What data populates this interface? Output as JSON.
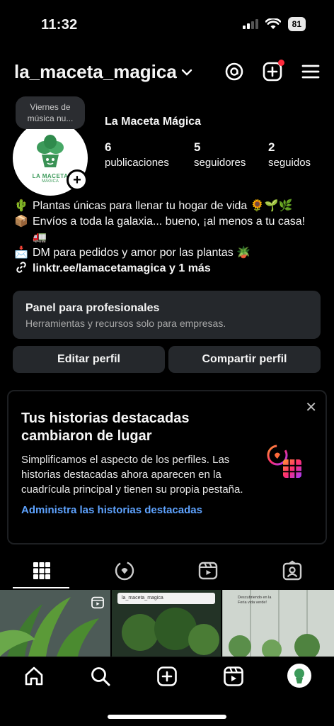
{
  "status": {
    "time": "11:32",
    "battery": "81"
  },
  "header": {
    "username": "la_maceta_magica"
  },
  "note": {
    "text_line1": "Viernes de",
    "text_line2": "música nu..."
  },
  "avatar": {
    "logo_line1": "LA MACETA",
    "logo_line2": "MÁGICA"
  },
  "profile": {
    "display_name": "La Maceta Mágica",
    "stats": [
      {
        "value": "6",
        "label": "publicaciones"
      },
      {
        "value": "5",
        "label": "seguidores"
      },
      {
        "value": "2",
        "label": "seguidos"
      }
    ]
  },
  "bio": {
    "line1": "Plantas únicas para llenar tu hogar de vida 🌻🌱🌿",
    "line2": "Envíos a toda la galaxia... bueno, ¡al menos a tu casa! 🚛",
    "line3": "DM para pedidos y amor por las plantas 🪴",
    "link": "linktr.ee/lamacetamagica y 1 más"
  },
  "pro_panel": {
    "title": "Panel para profesionales",
    "subtitle": "Herramientas y recursos solo para empresas."
  },
  "buttons": {
    "edit": "Editar perfil",
    "share": "Compartir perfil"
  },
  "highlights_card": {
    "title": "Tus historias destacadas cambiaron de lugar",
    "body": "Simplificamos el aspecto de los perfiles. Las historias destacadas ahora aparecen en la cuadrícula principal y tienen su propia pestaña.",
    "action": "Administra las historias destacadas"
  },
  "tile_texts": {
    "tile2_header": "la_maceta_magica",
    "tile3_caption": "Descubriendo en la Feria vida verde!"
  },
  "colors": {
    "background": "#000000",
    "panel": "#25282c",
    "link": "#5ea3ff",
    "notification": "#ff2a3c"
  }
}
